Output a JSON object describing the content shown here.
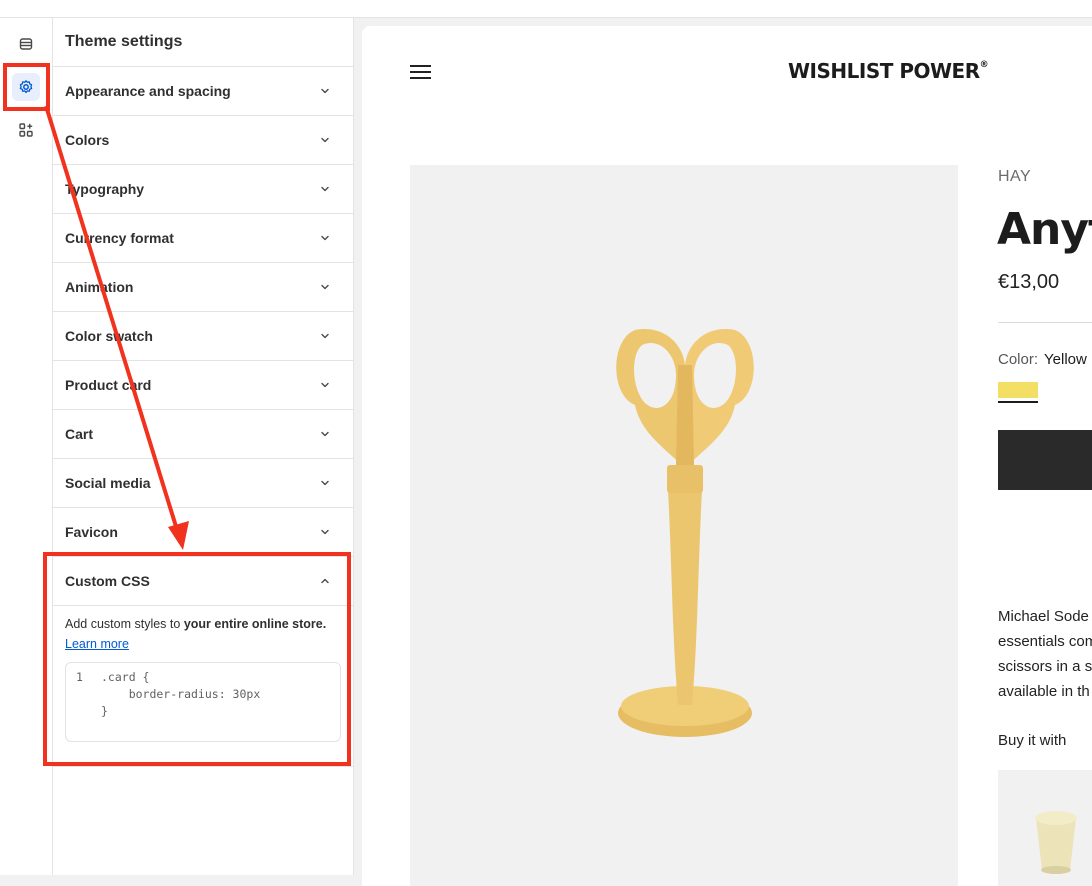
{
  "panel": {
    "title": "Theme settings",
    "sections": [
      {
        "label": "Appearance and spacing",
        "key": "appearance"
      },
      {
        "label": "Colors",
        "key": "colors"
      },
      {
        "label": "Typography",
        "key": "typography"
      },
      {
        "label": "Currency format",
        "key": "currency"
      },
      {
        "label": "Animation",
        "key": "animation"
      },
      {
        "label": "Color swatch",
        "key": "swatch"
      },
      {
        "label": "Product card",
        "key": "product-card"
      },
      {
        "label": "Cart",
        "key": "cart"
      },
      {
        "label": "Social media",
        "key": "social"
      },
      {
        "label": "Favicon",
        "key": "favicon"
      }
    ],
    "custom_css": {
      "label": "Custom CSS",
      "desc_prefix": "Add custom styles to ",
      "desc_bold": "your entire online store.",
      "learn_more": "Learn more",
      "line_number": "1",
      "code": [
        ".card {",
        "    border-radius: 30px",
        "}"
      ]
    }
  },
  "rail": {
    "icons": [
      "sections-icon",
      "theme-settings-gear-icon",
      "apps-icon"
    ]
  },
  "preview": {
    "logo": "WISHLIST POWER",
    "logo_mark": "®",
    "vendor": "HAY",
    "title": "Anyt",
    "price": "€13,00",
    "color_label": "Color:",
    "color_value": "Yellow",
    "description_lines": [
      "Michael Sode",
      "essentials com",
      "scissors in a s",
      "available in th"
    ],
    "buy_with": "Buy it with"
  },
  "colors": {
    "accent": "#005bd3",
    "highlight": "#f0321e",
    "swatch": "#f2df63",
    "button": "#2a2a2a"
  }
}
